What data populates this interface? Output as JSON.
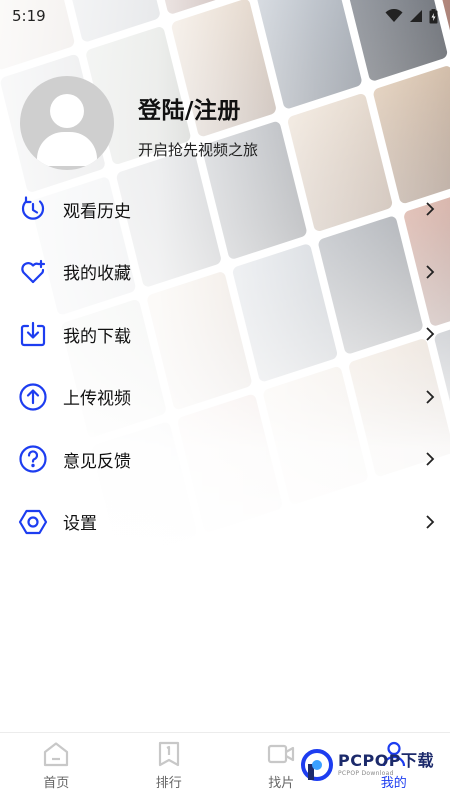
{
  "status_bar": {
    "time": "5:19"
  },
  "profile": {
    "title": "登陆/注册",
    "subtitle": "开启抢先视频之旅"
  },
  "menu": [
    {
      "label": "观看历史",
      "icon": "history-icon"
    },
    {
      "label": "我的收藏",
      "icon": "heart-plus-icon"
    },
    {
      "label": "我的下载",
      "icon": "download-icon"
    },
    {
      "label": "上传视频",
      "icon": "upload-icon"
    },
    {
      "label": "意见反馈",
      "icon": "help-icon"
    },
    {
      "label": "设置",
      "icon": "settings-icon"
    }
  ],
  "bottom_nav": [
    {
      "label": "首页",
      "icon": "home-icon",
      "active": false
    },
    {
      "label": "排行",
      "icon": "ranking-icon",
      "active": false
    },
    {
      "label": "找片",
      "icon": "video-camera-icon",
      "active": false
    },
    {
      "label": "我的",
      "icon": "user-icon",
      "active": true
    }
  ],
  "watermark": {
    "text": "PCPOP下载",
    "small": "PCPOP Download"
  },
  "colors": {
    "accent": "#1d3df0",
    "nav_inactive": "#c8c8c8"
  }
}
